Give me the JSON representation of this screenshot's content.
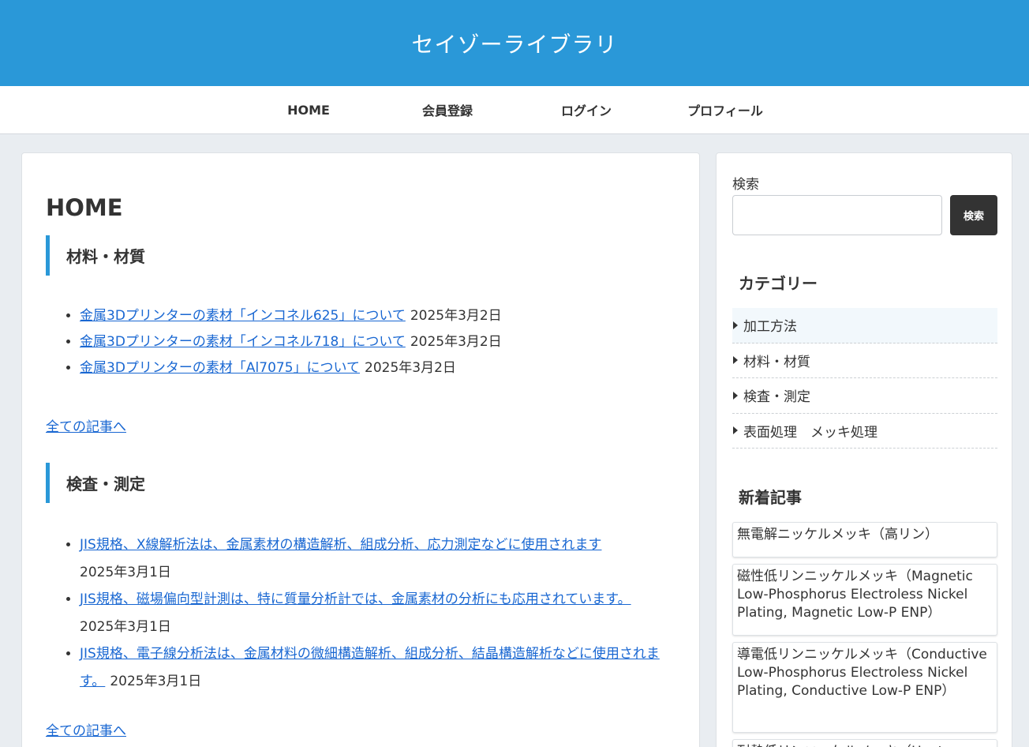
{
  "site": {
    "title": "セイゾーライブラリ"
  },
  "nav": {
    "items": [
      {
        "label": "HOME"
      },
      {
        "label": "会員登録"
      },
      {
        "label": "ログイン"
      },
      {
        "label": "プロフィール"
      }
    ]
  },
  "main": {
    "page_title": "HOME",
    "sections": [
      {
        "heading": "材料・材質",
        "posts": [
          {
            "title": "金属3Dプリンターの素材「インコネル625」について",
            "date": "2025年3月2日"
          },
          {
            "title": "金属3Dプリンターの素材「インコネル718」について",
            "date": "2025年3月2日"
          },
          {
            "title": "金属3Dプリンターの素材「Al7075」について",
            "date": "2025年3月2日"
          }
        ],
        "all_link": "全ての記事へ"
      },
      {
        "heading": "検査・測定",
        "posts": [
          {
            "title": "JIS規格、X線解析法は、金属素材の構造解析、組成分析、応力測定などに使用されます",
            "date": "2025年3月1日"
          },
          {
            "title": "JIS規格、磁場偏向型計測は、特に質量分析計では、金属素材の分析にも応用されています。",
            "date": "2025年3月1日"
          },
          {
            "title": "JIS規格、電子線分析法は、金属材料の微細構造解析、組成分析、結晶構造解析などに使用されます。",
            "date": "2025年3月1日"
          }
        ],
        "all_link": "全ての記事へ"
      }
    ]
  },
  "sidebar": {
    "search": {
      "label": "検索",
      "button": "検索",
      "value": "",
      "placeholder": ""
    },
    "categories": {
      "title": "カテゴリー",
      "items": [
        {
          "label": "加工方法"
        },
        {
          "label": "材料・材質"
        },
        {
          "label": "検査・測定"
        },
        {
          "label": "表面処理　メッキ処理"
        }
      ]
    },
    "recent": {
      "title": "新着記事",
      "items": [
        {
          "title": "無電解ニッケルメッキ（高リン）"
        },
        {
          "title": "磁性低リンニッケルメッキ（Magnetic Low-Phosphorus Electroless Nickel Plating, Magnetic Low-P ENP）"
        },
        {
          "title": "導電低リンニッケルメッキ（Conductive Low-Phosphorus Electroless Nickel Plating, Conductive Low-P ENP）"
        },
        {
          "title": "耐熱低リンニッケルメッキ（Heat-"
        }
      ]
    }
  },
  "colors": {
    "header_bg": "#2a98d8",
    "accent": "#2a98d8",
    "link": "#1967d2",
    "search_button_bg": "#333333"
  }
}
